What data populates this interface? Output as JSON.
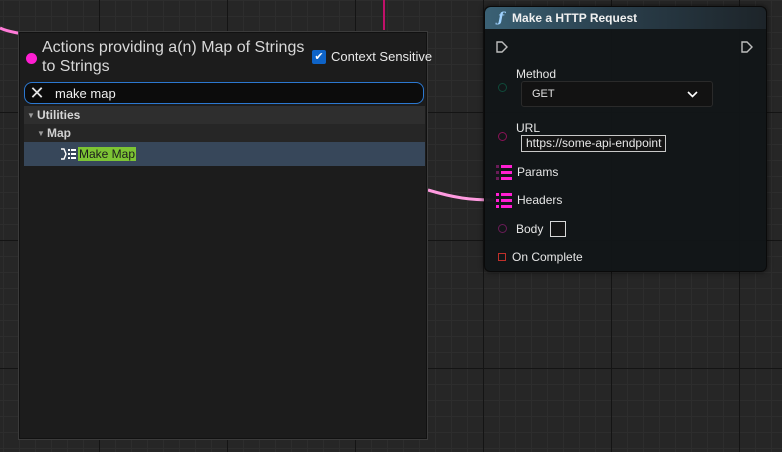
{
  "menu": {
    "title": "Actions providing a(n) Map of Strings to Strings",
    "context_sensitive": {
      "label": "Context Sensitive",
      "checked": true
    },
    "search": {
      "value": "make map"
    },
    "tree": {
      "category": "Utilities",
      "subcategory": "Map",
      "item": "Make Map"
    }
  },
  "node": {
    "title": "Make a HTTP Request",
    "header_icon": "function-icon",
    "method": {
      "label": "Method",
      "value": "GET"
    },
    "url": {
      "label": "URL",
      "value": "https://some-api-endpoint"
    },
    "params": {
      "label": "Params"
    },
    "headers": {
      "label": "Headers"
    },
    "body": {
      "label": "Body"
    },
    "on_complete": {
      "label": "On Complete"
    }
  },
  "colors": {
    "map_pin": "#ff1ed2",
    "string_pin": "#e8157e",
    "wire": "#ff7ad8",
    "highlight": "#7cc434",
    "selection": "#37475a",
    "delegate_pin": "#c0302a"
  }
}
